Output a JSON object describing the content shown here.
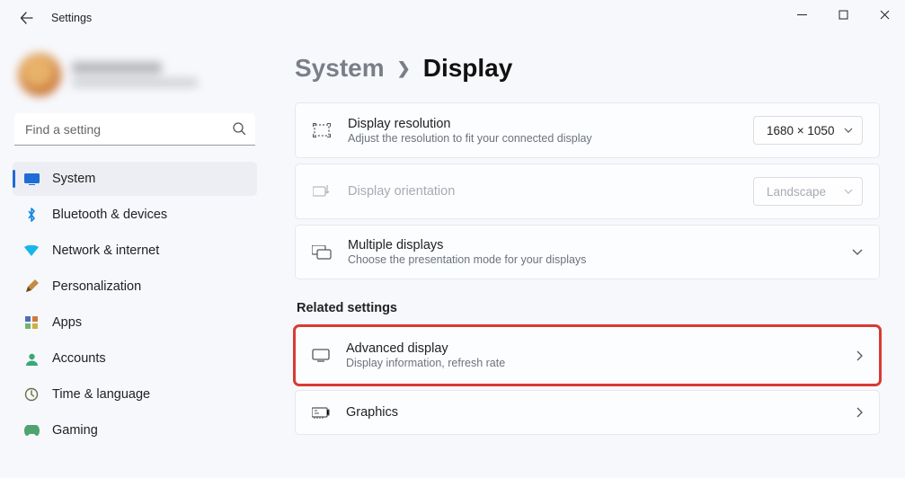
{
  "window": {
    "title": "Settings"
  },
  "search": {
    "placeholder": "Find a setting"
  },
  "sidebar": {
    "items": [
      {
        "label": "System"
      },
      {
        "label": "Bluetooth & devices"
      },
      {
        "label": "Network & internet"
      },
      {
        "label": "Personalization"
      },
      {
        "label": "Apps"
      },
      {
        "label": "Accounts"
      },
      {
        "label": "Time & language"
      },
      {
        "label": "Gaming"
      }
    ]
  },
  "breadcrumb": {
    "parent": "System",
    "current": "Display"
  },
  "cards": {
    "resolution": {
      "title": "Display resolution",
      "desc": "Adjust the resolution to fit your connected display",
      "value": "1680 × 1050"
    },
    "orientation": {
      "title": "Display orientation",
      "value": "Landscape"
    },
    "multiple": {
      "title": "Multiple displays",
      "desc": "Choose the presentation mode for your displays"
    }
  },
  "related": {
    "heading": "Related settings",
    "advanced": {
      "title": "Advanced display",
      "desc": "Display information, refresh rate"
    },
    "graphics": {
      "title": "Graphics"
    }
  }
}
